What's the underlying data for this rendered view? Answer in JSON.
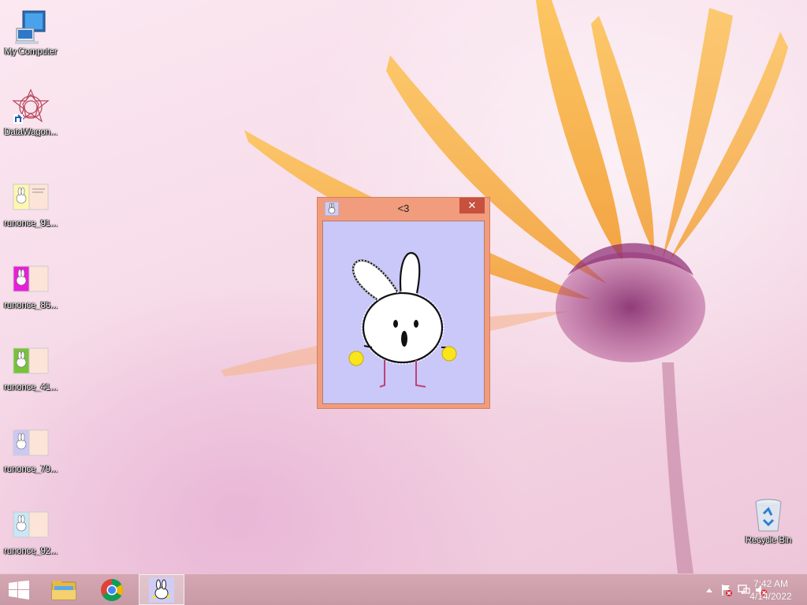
{
  "desktop": {
    "icons": [
      {
        "label": "My Computer",
        "icon": "computer-icon"
      },
      {
        "label": "DataWagon...",
        "icon": "datawagon-icon"
      },
      {
        "label": "runonce_91...",
        "icon": "bunny-thumbnail-icon"
      },
      {
        "label": "runonce_86...",
        "icon": "bunny-thumbnail-icon"
      },
      {
        "label": "runonce_41...",
        "icon": "bunny-thumbnail-icon"
      },
      {
        "label": "runonce_79...",
        "icon": "bunny-thumbnail-icon"
      },
      {
        "label": "runonce_92...",
        "icon": "bunny-thumbnail-icon"
      },
      {
        "label": "Recycle Bin",
        "icon": "recycle-bin-icon"
      }
    ]
  },
  "window": {
    "title": "<3",
    "close_glyph": "✕",
    "icon": "bunny-icon"
  },
  "taskbar": {
    "buttons": [
      {
        "name": "start",
        "icon": "windows-logo-icon"
      },
      {
        "name": "file-explorer",
        "icon": "folder-icon"
      },
      {
        "name": "chrome",
        "icon": "chrome-icon"
      },
      {
        "name": "app",
        "icon": "bunny-icon",
        "active": true
      }
    ],
    "tray": {
      "icons": [
        "show-hidden-icons-icon",
        "action-center-flag-icon",
        "network-icon",
        "volume-muted-icon"
      ],
      "time": "7:42 AM",
      "date": "4/14/2022"
    }
  },
  "colors": {
    "window_frame": "#f19c7d",
    "close_button": "#c7503f",
    "client_bg": "#c9c8f8",
    "taskbar": "#cc9eaa"
  }
}
